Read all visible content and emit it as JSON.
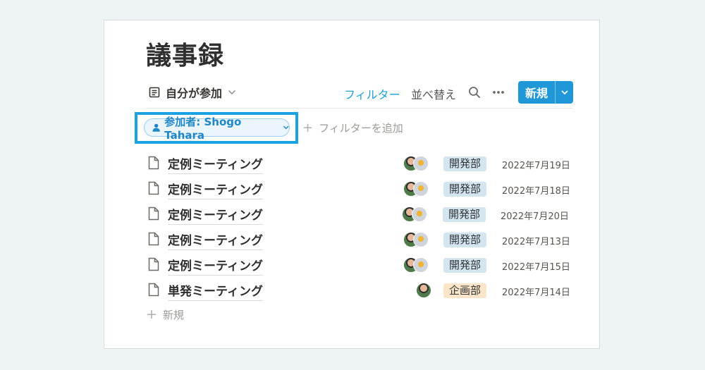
{
  "page": {
    "title": "議事録"
  },
  "toolbar": {
    "view_label": "自分が参加",
    "filter_label": "フィルター",
    "sort_label": "並べ替え",
    "new_label": "新規",
    "icons": {
      "view": "page-list-icon",
      "search": "search-icon",
      "more": "more-icon",
      "caret": "chevron-down-icon"
    }
  },
  "filter": {
    "chip_label": "参加者: Shogo Tahara",
    "add_label": "フィルターを追加",
    "highlight_color": "#1aa3e0"
  },
  "rows": [
    {
      "title": "定例ミーティング",
      "avatars": [
        "person-photo",
        "bear-photo"
      ],
      "tag": "開発部",
      "tag_color": "#d3e5ef",
      "date": "2022年7月19日"
    },
    {
      "title": "定例ミーティング",
      "avatars": [
        "person-photo",
        "bear-photo"
      ],
      "tag": "開発部",
      "tag_color": "#d3e5ef",
      "date": "2022年7月18日"
    },
    {
      "title": "定例ミーティング",
      "avatars": [
        "person-photo",
        "bear-photo"
      ],
      "tag": "開発部",
      "tag_color": "#d3e5ef",
      "date": "2022年7月20日"
    },
    {
      "title": "定例ミーティング",
      "avatars": [
        "person-photo",
        "bear-photo"
      ],
      "tag": "開発部",
      "tag_color": "#d3e5ef",
      "date": "2022年7月13日"
    },
    {
      "title": "定例ミーティング",
      "avatars": [
        "person-photo",
        "bear-photo"
      ],
      "tag": "開発部",
      "tag_color": "#d3e5ef",
      "date": "2022年7月15日"
    },
    {
      "title": "単発ミーティング",
      "avatars": [
        "person-photo"
      ],
      "tag": "企画部",
      "tag_color": "#fae5c8",
      "date": "2022年7月14日"
    }
  ],
  "new_row_label": "新規",
  "colors": {
    "accent": "#2097d6",
    "link": "#1f9fd8",
    "background": "#eef3f3"
  }
}
